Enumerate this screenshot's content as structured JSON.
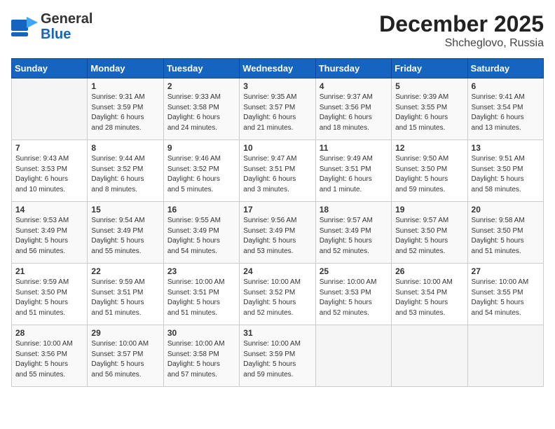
{
  "header": {
    "logo_general": "General",
    "logo_blue": "Blue",
    "month": "December 2025",
    "location": "Shcheglovo, Russia"
  },
  "days_of_week": [
    "Sunday",
    "Monday",
    "Tuesday",
    "Wednesday",
    "Thursday",
    "Friday",
    "Saturday"
  ],
  "weeks": [
    [
      {
        "day": "",
        "info": ""
      },
      {
        "day": "1",
        "info": "Sunrise: 9:31 AM\nSunset: 3:59 PM\nDaylight: 6 hours\nand 28 minutes."
      },
      {
        "day": "2",
        "info": "Sunrise: 9:33 AM\nSunset: 3:58 PM\nDaylight: 6 hours\nand 24 minutes."
      },
      {
        "day": "3",
        "info": "Sunrise: 9:35 AM\nSunset: 3:57 PM\nDaylight: 6 hours\nand 21 minutes."
      },
      {
        "day": "4",
        "info": "Sunrise: 9:37 AM\nSunset: 3:56 PM\nDaylight: 6 hours\nand 18 minutes."
      },
      {
        "day": "5",
        "info": "Sunrise: 9:39 AM\nSunset: 3:55 PM\nDaylight: 6 hours\nand 15 minutes."
      },
      {
        "day": "6",
        "info": "Sunrise: 9:41 AM\nSunset: 3:54 PM\nDaylight: 6 hours\nand 13 minutes."
      }
    ],
    [
      {
        "day": "7",
        "info": "Sunrise: 9:43 AM\nSunset: 3:53 PM\nDaylight: 6 hours\nand 10 minutes."
      },
      {
        "day": "8",
        "info": "Sunrise: 9:44 AM\nSunset: 3:52 PM\nDaylight: 6 hours\nand 8 minutes."
      },
      {
        "day": "9",
        "info": "Sunrise: 9:46 AM\nSunset: 3:52 PM\nDaylight: 6 hours\nand 5 minutes."
      },
      {
        "day": "10",
        "info": "Sunrise: 9:47 AM\nSunset: 3:51 PM\nDaylight: 6 hours\nand 3 minutes."
      },
      {
        "day": "11",
        "info": "Sunrise: 9:49 AM\nSunset: 3:51 PM\nDaylight: 6 hours\nand 1 minute."
      },
      {
        "day": "12",
        "info": "Sunrise: 9:50 AM\nSunset: 3:50 PM\nDaylight: 5 hours\nand 59 minutes."
      },
      {
        "day": "13",
        "info": "Sunrise: 9:51 AM\nSunset: 3:50 PM\nDaylight: 5 hours\nand 58 minutes."
      }
    ],
    [
      {
        "day": "14",
        "info": "Sunrise: 9:53 AM\nSunset: 3:49 PM\nDaylight: 5 hours\nand 56 minutes."
      },
      {
        "day": "15",
        "info": "Sunrise: 9:54 AM\nSunset: 3:49 PM\nDaylight: 5 hours\nand 55 minutes."
      },
      {
        "day": "16",
        "info": "Sunrise: 9:55 AM\nSunset: 3:49 PM\nDaylight: 5 hours\nand 54 minutes."
      },
      {
        "day": "17",
        "info": "Sunrise: 9:56 AM\nSunset: 3:49 PM\nDaylight: 5 hours\nand 53 minutes."
      },
      {
        "day": "18",
        "info": "Sunrise: 9:57 AM\nSunset: 3:49 PM\nDaylight: 5 hours\nand 52 minutes."
      },
      {
        "day": "19",
        "info": "Sunrise: 9:57 AM\nSunset: 3:50 PM\nDaylight: 5 hours\nand 52 minutes."
      },
      {
        "day": "20",
        "info": "Sunrise: 9:58 AM\nSunset: 3:50 PM\nDaylight: 5 hours\nand 51 minutes."
      }
    ],
    [
      {
        "day": "21",
        "info": "Sunrise: 9:59 AM\nSunset: 3:50 PM\nDaylight: 5 hours\nand 51 minutes."
      },
      {
        "day": "22",
        "info": "Sunrise: 9:59 AM\nSunset: 3:51 PM\nDaylight: 5 hours\nand 51 minutes."
      },
      {
        "day": "23",
        "info": "Sunrise: 10:00 AM\nSunset: 3:51 PM\nDaylight: 5 hours\nand 51 minutes."
      },
      {
        "day": "24",
        "info": "Sunrise: 10:00 AM\nSunset: 3:52 PM\nDaylight: 5 hours\nand 52 minutes."
      },
      {
        "day": "25",
        "info": "Sunrise: 10:00 AM\nSunset: 3:53 PM\nDaylight: 5 hours\nand 52 minutes."
      },
      {
        "day": "26",
        "info": "Sunrise: 10:00 AM\nSunset: 3:54 PM\nDaylight: 5 hours\nand 53 minutes."
      },
      {
        "day": "27",
        "info": "Sunrise: 10:00 AM\nSunset: 3:55 PM\nDaylight: 5 hours\nand 54 minutes."
      }
    ],
    [
      {
        "day": "28",
        "info": "Sunrise: 10:00 AM\nSunset: 3:56 PM\nDaylight: 5 hours\nand 55 minutes."
      },
      {
        "day": "29",
        "info": "Sunrise: 10:00 AM\nSunset: 3:57 PM\nDaylight: 5 hours\nand 56 minutes."
      },
      {
        "day": "30",
        "info": "Sunrise: 10:00 AM\nSunset: 3:58 PM\nDaylight: 5 hours\nand 57 minutes."
      },
      {
        "day": "31",
        "info": "Sunrise: 10:00 AM\nSunset: 3:59 PM\nDaylight: 5 hours\nand 59 minutes."
      },
      {
        "day": "",
        "info": ""
      },
      {
        "day": "",
        "info": ""
      },
      {
        "day": "",
        "info": ""
      }
    ]
  ]
}
